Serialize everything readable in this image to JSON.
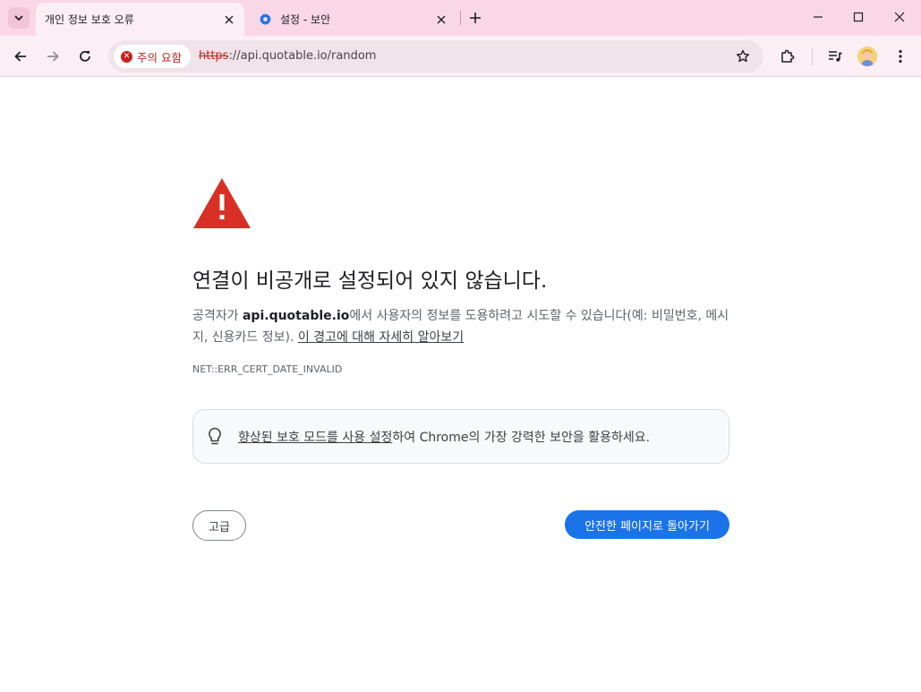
{
  "tabs": [
    {
      "title": "개인 정보 보호 오류",
      "active": true
    },
    {
      "title": "설정 - 보안",
      "active": false,
      "icon": "gear-icon"
    }
  ],
  "toolbar": {
    "warning_chip": "주의 요함",
    "url_scheme": "https",
    "url_rest": "://api.quotable.io/random"
  },
  "page": {
    "headline": "연결이 비공개로 설정되어 있지 않습니다.",
    "desc_before": "공격자가 ",
    "desc_host": "api.quotable.io",
    "desc_after": "에서 사용자의 정보를 도용하려고 시도할 수 있습니다(예: 비밀번호, 메시지, 신용카드 정보). ",
    "learn_more_link": "이 경고에 대해 자세히 알아보기",
    "error_code": "NET::ERR_CERT_DATE_INVALID",
    "callout_link": "향상된 보호 모드를 사용 설정",
    "callout_rest": "하여 Chrome의 가장 강력한 보안을 활용하세요.",
    "advanced_button": "고급",
    "back_button": "안전한 페이지로 돌아가기"
  },
  "colors": {
    "tabstrip_bg": "#f9d7e6",
    "toolbar_bg": "#fbeff5",
    "danger_red": "#c5221f",
    "primary_blue": "#1a73e8"
  }
}
